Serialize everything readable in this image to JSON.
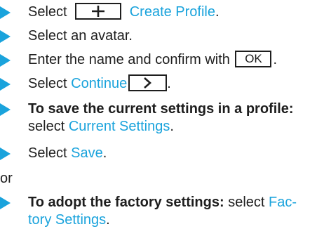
{
  "steps": [
    {
      "text": "Select",
      "link": "Create Profile",
      "icon": "plus-icon"
    },
    {
      "text": "Select an avatar."
    },
    {
      "text": "Enter the name and confirm with",
      "button": "OK",
      "end": "."
    },
    {
      "text": "Select",
      "link": "Continue",
      "icon": "chevron-right-icon",
      "end": "."
    },
    {
      "bold": "To save the current settings in a profile:",
      "text2": "select",
      "link": "Current Settings",
      "end": "."
    },
    {
      "text": "Select",
      "link": "Save",
      "end": "."
    },
    {
      "bold": "To adopt the factory settings:",
      "text2": "select",
      "link_a": "Fac-",
      "link_b": "tory Settings",
      "end": "."
    }
  ],
  "separator": "or",
  "colors": {
    "accent": "#1aa3dc",
    "text": "#1e1e1e"
  }
}
